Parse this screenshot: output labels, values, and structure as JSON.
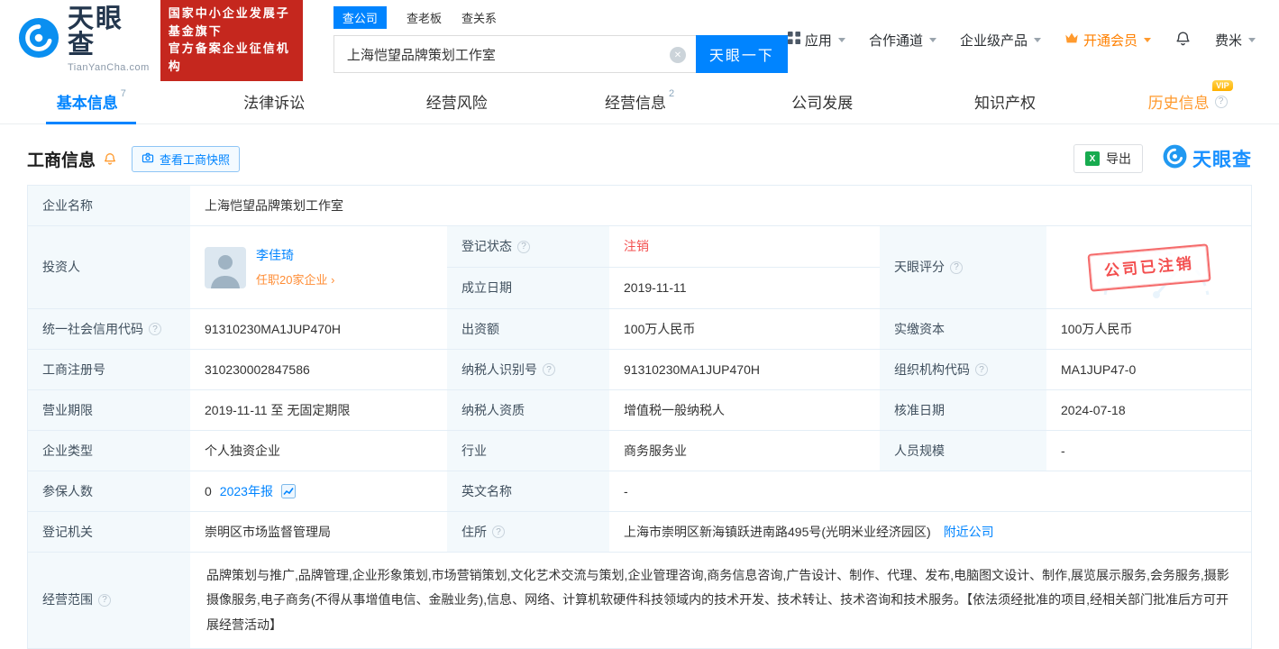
{
  "colors": {
    "brand_blue": "#0084ff",
    "badge_red": "#c5271e",
    "status_red": "#f34f4f",
    "vip_orange": "#ff9a2e",
    "link_orange": "#ff8d35",
    "label_bg": "#f3f9fc",
    "excel_green": "#17ab4f"
  },
  "icons": {
    "question": "?",
    "clear": "✕",
    "chevron": "›",
    "excel": "X"
  },
  "brand": {
    "logo_text": "天眼查",
    "logo_sub": "TianYanCha.com",
    "badge_line1": "国家中小企业发展子基金旗下",
    "badge_line2": "官方备案企业征信机构"
  },
  "search": {
    "tabs": [
      "查公司",
      "查老板",
      "查关系"
    ],
    "value": "上海恺望品牌策划工作室",
    "button_label": "天眼一下"
  },
  "header_menu": {
    "apps": "应用",
    "cooperation": "合作通道",
    "enterprise_products": "企业级产品",
    "vip": "开通会员",
    "username": "费米"
  },
  "nav_tabs": [
    {
      "label": "基本信息",
      "count": "7"
    },
    {
      "label": "法律诉讼"
    },
    {
      "label": "经营风险"
    },
    {
      "label": "经营信息",
      "count": "2"
    },
    {
      "label": "公司发展"
    },
    {
      "label": "知识产权"
    },
    {
      "label": "历史信息",
      "vip_tag": "VIP"
    }
  ],
  "section": {
    "title": "工商信息",
    "snapshot_button": "查看工商快照",
    "export_button": "导出",
    "watermark": "天眼查"
  },
  "table": {
    "company_name": {
      "label": "企业名称",
      "value": "上海恺望品牌策划工作室"
    },
    "investor": {
      "label": "投资人",
      "name": "李佳琦",
      "positions_link": "任职20家企业"
    },
    "reg_status": {
      "label": "登记状态",
      "value": "注销"
    },
    "establish_date": {
      "label": "成立日期",
      "value": "2019-11-11"
    },
    "tyc_score": {
      "label": "天眼评分"
    },
    "stamp_text": "公司已注销",
    "credit_code": {
      "label": "统一社会信用代码",
      "value": "91310230MA1JUP470H"
    },
    "capital": {
      "label": "出资额",
      "value": "100万人民币"
    },
    "paid_capital": {
      "label": "实缴资本",
      "value": "100万人民币"
    },
    "reg_number": {
      "label": "工商注册号",
      "value": "310230002847586"
    },
    "taxpayer_id": {
      "label": "纳税人识别号",
      "value": "91310230MA1JUP470H"
    },
    "org_code": {
      "label": "组织机构代码",
      "value": "MA1JUP47-0"
    },
    "business_term": {
      "label": "营业期限",
      "value": "2019-11-11 至 无固定期限"
    },
    "taxpayer_quality": {
      "label": "纳税人资质",
      "value": "增值税一般纳税人"
    },
    "approval_date": {
      "label": "核准日期",
      "value": "2024-07-18"
    },
    "company_type": {
      "label": "企业类型",
      "value": "个人独资企业"
    },
    "industry": {
      "label": "行业",
      "value": "商务服务业"
    },
    "staff_size": {
      "label": "人员规模",
      "value": "-"
    },
    "insured": {
      "label": "参保人数",
      "value": "0",
      "report_link": "2023年报"
    },
    "english_name": {
      "label": "英文名称",
      "value": "-"
    },
    "reg_authority": {
      "label": "登记机关",
      "value": "崇明区市场监督管理局"
    },
    "address": {
      "label": "住所",
      "value": "上海市崇明区新海镇跃进南路495号(光明米业经济园区)",
      "nearby_link": "附近公司"
    },
    "business_scope": {
      "label": "经营范围",
      "value": "品牌策划与推广,品牌管理,企业形象策划,市场营销策划,文化艺术交流与策划,企业管理咨询,商务信息咨询,广告设计、制作、代理、发布,电脑图文设计、制作,展览展示服务,会务服务,摄影摄像服务,电子商务(不得从事增值电信、金融业务),信息、网络、计算机软硬件科技领域内的技术开发、技术转让、技术咨询和技术服务。【依法须经批准的项目,经相关部门批准后方可开展经营活动】"
    }
  }
}
